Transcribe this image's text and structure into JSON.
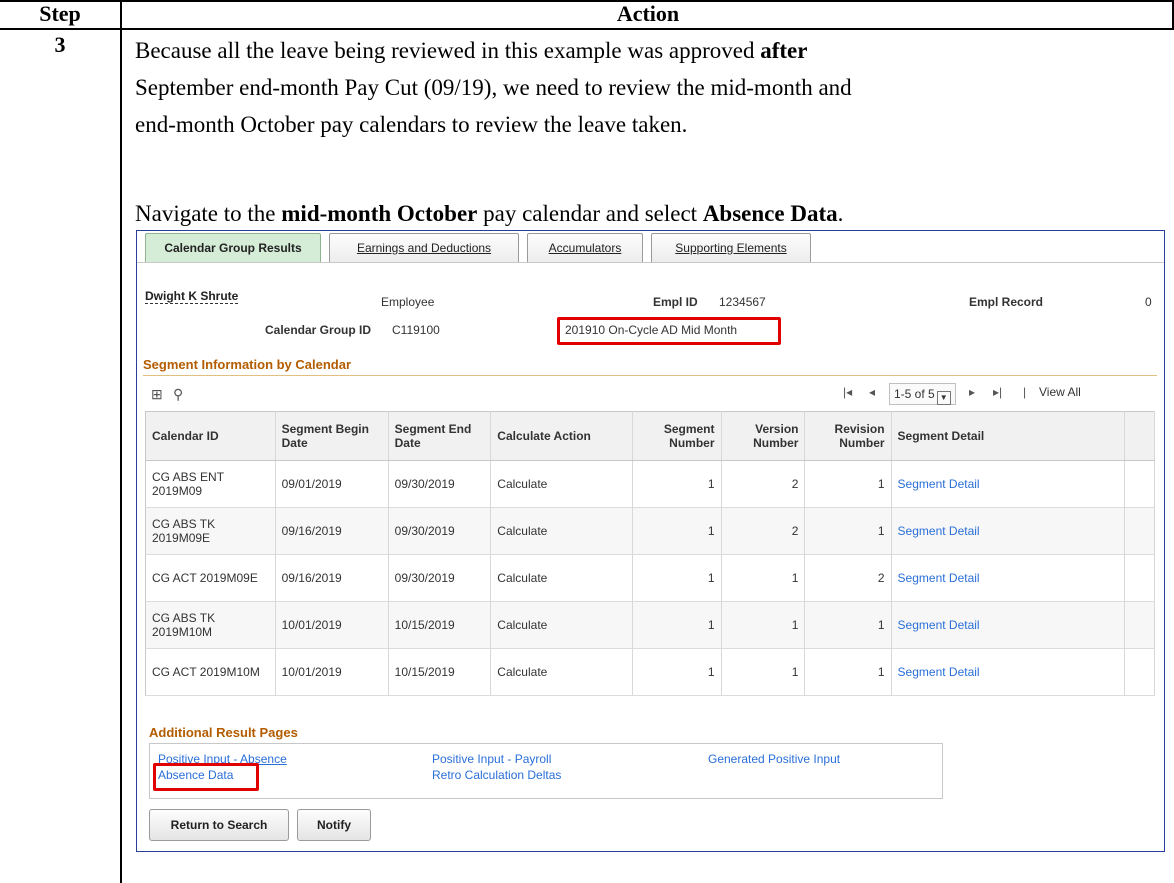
{
  "doc": {
    "header_step": "Step",
    "header_action": "Action",
    "step_number": "3",
    "para1_a": "Because all the leave being reviewed in this example was approved ",
    "para1_b": "after",
    "para1_c": "September end-month Pay Cut (09/19), we need to review the mid-month and",
    "para1_d": "end-month October pay calendars to review the leave taken.",
    "para2_a": "Navigate to the ",
    "para2_b": "mid-month October",
    "para2_c": " pay calendar and select ",
    "para2_d": "Absence Data",
    "para2_e": "."
  },
  "ps": {
    "tabs": [
      {
        "label": "Calendar Group Results",
        "active": true
      },
      {
        "label": "Earnings and Deductions",
        "active": false
      },
      {
        "label": "Accumulators",
        "active": false
      },
      {
        "label": "Supporting Elements",
        "active": false
      }
    ],
    "employee_name": "Dwight K Shrute",
    "employee_label": "Employee",
    "empl_id_label": "Empl ID",
    "empl_id_value": "1234567",
    "empl_record_label": "Empl Record",
    "empl_record_value": "0",
    "cal_group_label": "Calendar Group ID",
    "cal_group_value": "C119100",
    "cal_group_desc": "201910 On-Cycle AD Mid Month",
    "segment_section_title": "Segment Information by Calendar",
    "pager_text": "1-5 of 5",
    "view_all": "View All",
    "columns": [
      "Calendar ID",
      "Segment Begin Date",
      "Segment End Date",
      "Calculate Action",
      "Segment Number",
      "Version Number",
      "Revision Number",
      "Segment Detail"
    ],
    "rows": [
      {
        "cal_id": "CG ABS ENT 2019M09",
        "begin": "09/01/2019",
        "end": "09/30/2019",
        "action": "Calculate",
        "seg": "1",
        "ver": "2",
        "rev": "1",
        "detail": "Segment Detail"
      },
      {
        "cal_id": "CG ABS TK 2019M09E",
        "begin": "09/16/2019",
        "end": "09/30/2019",
        "action": "Calculate",
        "seg": "1",
        "ver": "2",
        "rev": "1",
        "detail": "Segment Detail"
      },
      {
        "cal_id": "CG ACT 2019M09E",
        "begin": "09/16/2019",
        "end": "09/30/2019",
        "action": "Calculate",
        "seg": "1",
        "ver": "1",
        "rev": "2",
        "detail": "Segment Detail"
      },
      {
        "cal_id": "CG ABS TK 2019M10M",
        "begin": "10/01/2019",
        "end": "10/15/2019",
        "action": "Calculate",
        "seg": "1",
        "ver": "1",
        "rev": "1",
        "detail": "Segment Detail"
      },
      {
        "cal_id": "CG ACT 2019M10M",
        "begin": "10/01/2019",
        "end": "10/15/2019",
        "action": "Calculate",
        "seg": "1",
        "ver": "1",
        "rev": "1",
        "detail": "Segment Detail"
      }
    ],
    "additional_title": "Additional Result Pages",
    "links": {
      "positive_input_absence": "Positive Input - Absence",
      "absence_data": "Absence Data",
      "positive_input_payroll": "Positive Input - Payroll",
      "retro_calc_deltas": "Retro Calculation Deltas",
      "generated_positive_input": "Generated Positive Input"
    },
    "buttons": {
      "return_to_search": "Return to Search",
      "notify": "Notify"
    }
  }
}
